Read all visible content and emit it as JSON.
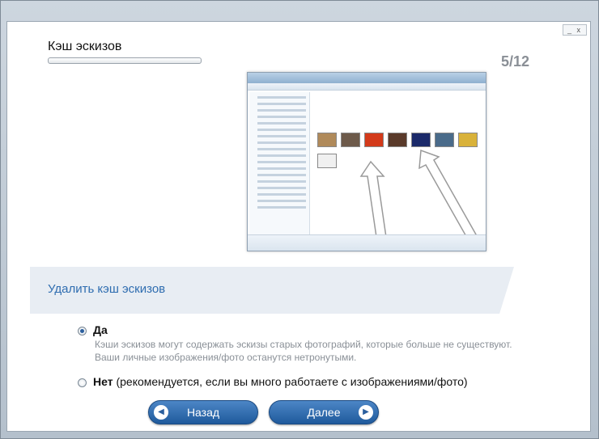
{
  "window": {
    "close_glyphs": "_ x"
  },
  "header": {
    "title": "Кэш эскизов",
    "step": "5/12"
  },
  "preview": {
    "thumb_colors": [
      "#b08a5a",
      "#6d5a4a",
      "#d33a1a",
      "#5a3a2a",
      "#1b2a6a",
      "#4a6b8a",
      "#d9b23a",
      "#f0f0f0"
    ]
  },
  "action": {
    "title": "Удалить кэш эскизов"
  },
  "options": {
    "yes": {
      "label": "Да",
      "selected": true,
      "desc_line1": "Кэши эскизов могут содержать эскизы старых фотографий, которые больше не существуют.",
      "desc_line2": "Ваши личные изображения/фото останутся нетронутыми."
    },
    "no": {
      "label": "Нет",
      "selected": false,
      "suffix": " (рекомендуется, если вы много работаете с изображениями/фото)"
    }
  },
  "nav": {
    "back_label": "Назад",
    "next_label": "Далее",
    "back_icon": "chevron-left-icon",
    "next_icon": "chevron-right-icon"
  },
  "colors": {
    "accent": "#2f6db0",
    "button": "#2b5f9e"
  }
}
